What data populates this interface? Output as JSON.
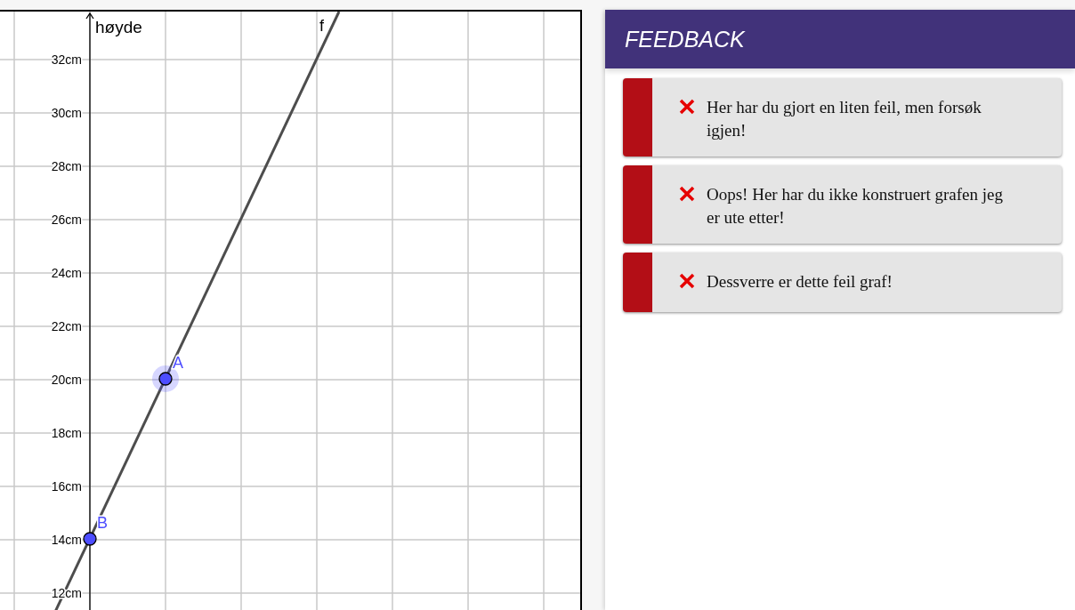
{
  "graph": {
    "axis_label": "høyde",
    "function_label": "f",
    "y_labels": [
      "32cm",
      "30cm",
      "28cm",
      "26cm",
      "24cm",
      "22cm",
      "20cm",
      "18cm",
      "16cm",
      "14cm",
      "12cm"
    ],
    "points": [
      {
        "label": "A",
        "selected": true
      },
      {
        "label": "B",
        "selected": false
      }
    ]
  },
  "feedback": {
    "title": "FEEDBACK",
    "items": [
      {
        "kind": "error",
        "text": "Her har du gjort en liten feil, men forsøk igjen!"
      },
      {
        "kind": "error",
        "text": "Oops! Her har du ikke konstruert grafen jeg er ute etter!"
      },
      {
        "kind": "error",
        "text": "Dessverre er dette feil graf!"
      }
    ]
  }
}
